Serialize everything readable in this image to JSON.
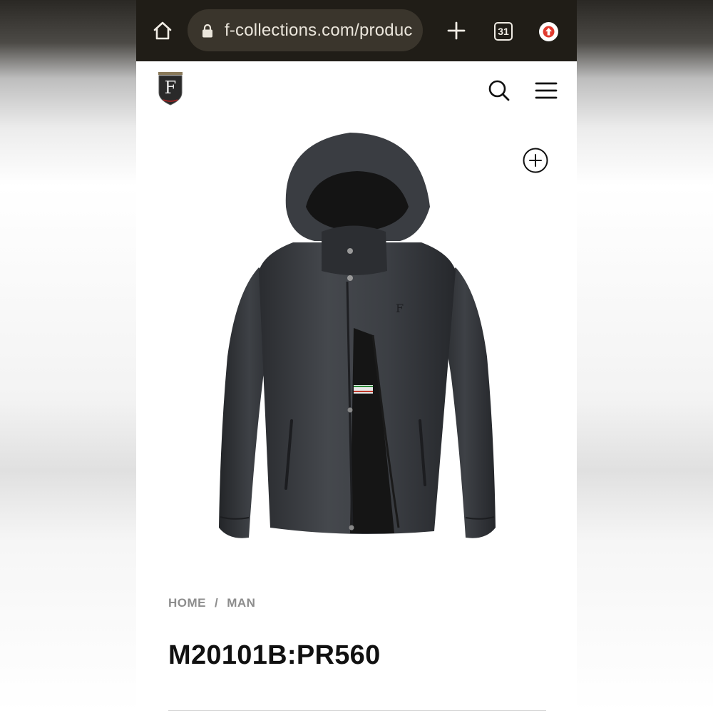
{
  "browser": {
    "url": "f-collections.com/produc",
    "tab_count": "31",
    "colors": {
      "toolbar": "#201d17",
      "urlbar": "#3a352c",
      "profile_badge": "#e03a2e"
    }
  },
  "site": {
    "logo_letter": "F",
    "breadcrumb": {
      "home": "HOME",
      "separator": "/",
      "category": "MAN"
    },
    "product_title": "M20101B:PR560",
    "product_image_logo": "F"
  }
}
